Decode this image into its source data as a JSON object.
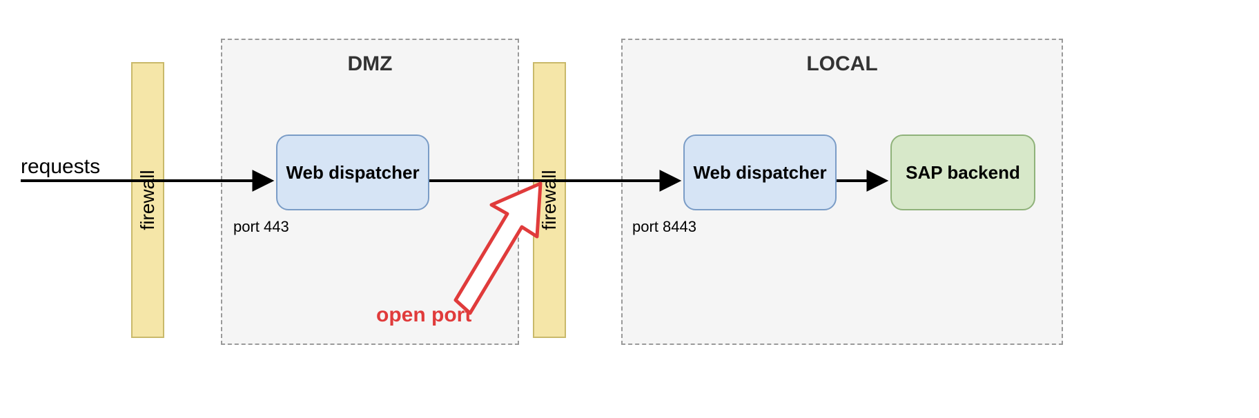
{
  "requests_label": "requests",
  "firewall_label": "firewall",
  "zones": {
    "dmz": {
      "title": "DMZ"
    },
    "local": {
      "title": "LOCAL"
    }
  },
  "nodes": {
    "web_dispatcher_dmz": "Web dispatcher",
    "web_dispatcher_local": "Web dispatcher",
    "sap_backend": "SAP backend"
  },
  "ports": {
    "dmz": "port 443",
    "local": "port 8443"
  },
  "annotation": {
    "open_port": "open port"
  },
  "colors": {
    "firewall_fill": "#f5e6a8",
    "firewall_border": "#c9b96a",
    "zone_fill": "#f5f5f5",
    "zone_border": "#999999",
    "node_blue_fill": "#d6e4f5",
    "node_blue_border": "#7a9cc6",
    "node_green_fill": "#d7e8c9",
    "node_green_border": "#8fb27a",
    "annotation_red": "#e03b3b",
    "arrow_black": "#000000"
  }
}
